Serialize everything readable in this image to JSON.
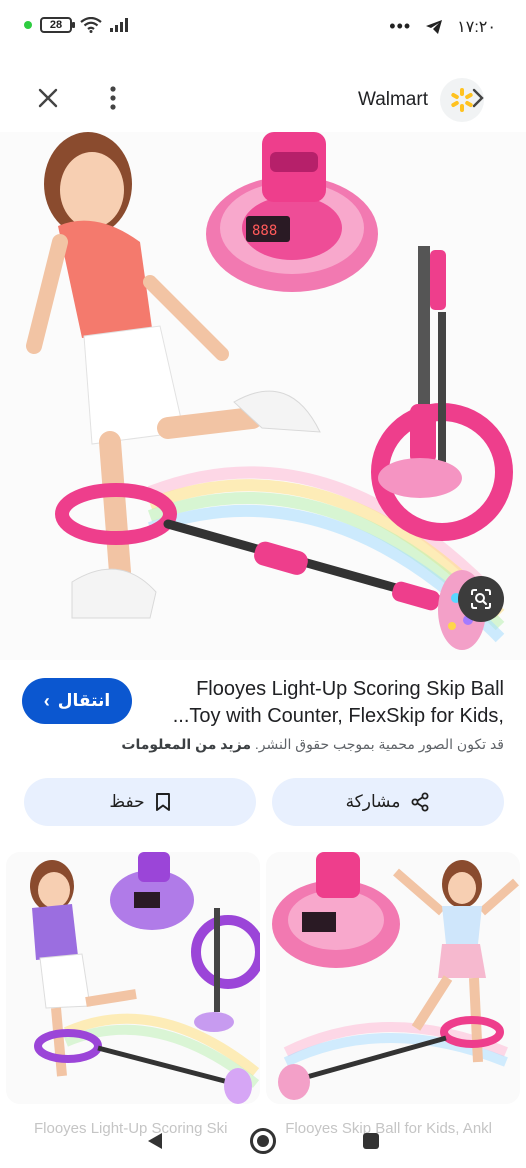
{
  "status_bar": {
    "battery": "28",
    "time": "١٧:٢٠"
  },
  "header": {
    "source_name": "Walmart"
  },
  "result": {
    "title_line1": "Flooyes Light-Up Scoring Skip Ball",
    "title_line2": "...Toy with Counter, FlexSkip for Kids,",
    "visit_label": "انتقال",
    "copyright_text": "قد تكون الصور محمية بموجب حقوق النشر.",
    "learn_more": "مزيد من المعلومات"
  },
  "actions": {
    "share_label": "مشاركة",
    "save_label": "حفظ"
  },
  "related": {
    "caption_left": "Flooyes Light-Up Scoring Ski",
    "caption_right": "Flooyes Skip Ball for Kids, Ankl"
  },
  "colors": {
    "accent": "#0b57d0",
    "action_bg": "#e8f0fe",
    "pink": "#ec3e8c",
    "purple": "#9b45d8"
  }
}
